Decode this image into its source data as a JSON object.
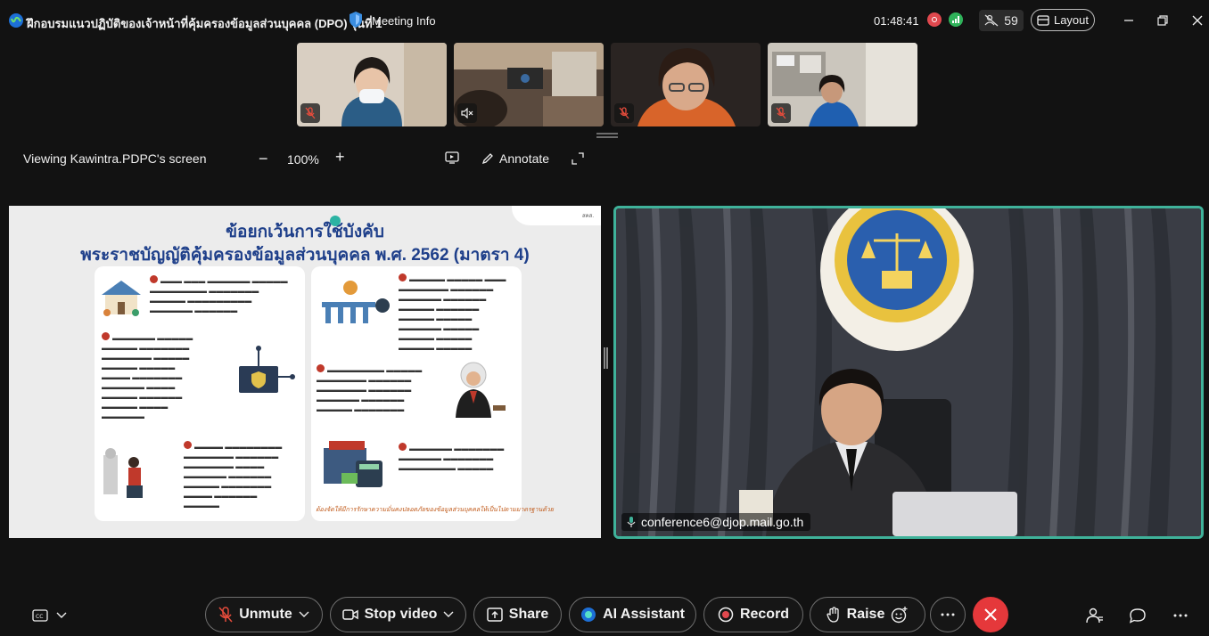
{
  "titlebar": {
    "meeting_title": "ฝึกอบรมแนวปฏิบัติของเจ้าหน้าที่คุ้มครองข้อมูลส่วนบุคคล (DPO) รุ่นที่ 1",
    "meeting_info": "Meeting Info",
    "clock": "01:48:41",
    "participant_count": "59",
    "layout_label": "Layout"
  },
  "share_bar": {
    "viewing_label": "Viewing Kawintra.PDPC's screen",
    "zoom_minus": "−",
    "zoom_level": "100%",
    "zoom_plus": "+",
    "annotate_label": "Annotate"
  },
  "slide": {
    "title_line1": "ข้อยกเว้นการใช้บังคับ",
    "title_line2": "พระราชบัญญัติคุ้มครองข้อมูลส่วนบุคคล พ.ศ. 2562 (มาตรา 4)",
    "corner_text": "สคส.",
    "footnote": "ต้องจัดให้มีการรักษาความมั่นคงปลอดภัยของข้อมูลส่วนบุคคลให้เป็นไปตามมาตรฐานด้วย"
  },
  "speaker": {
    "name": "conference6@djop.mail.go.th"
  },
  "controls": {
    "unmute": "Unmute",
    "stop_video": "Stop video",
    "share": "Share",
    "ai_assistant": "AI Assistant",
    "record": "Record",
    "raise": "Raise"
  },
  "colors": {
    "accent": "#3fb29a",
    "end_call": "#e5383b",
    "record_dot": "#e0484e",
    "slide_title": "#1e3f8a"
  }
}
